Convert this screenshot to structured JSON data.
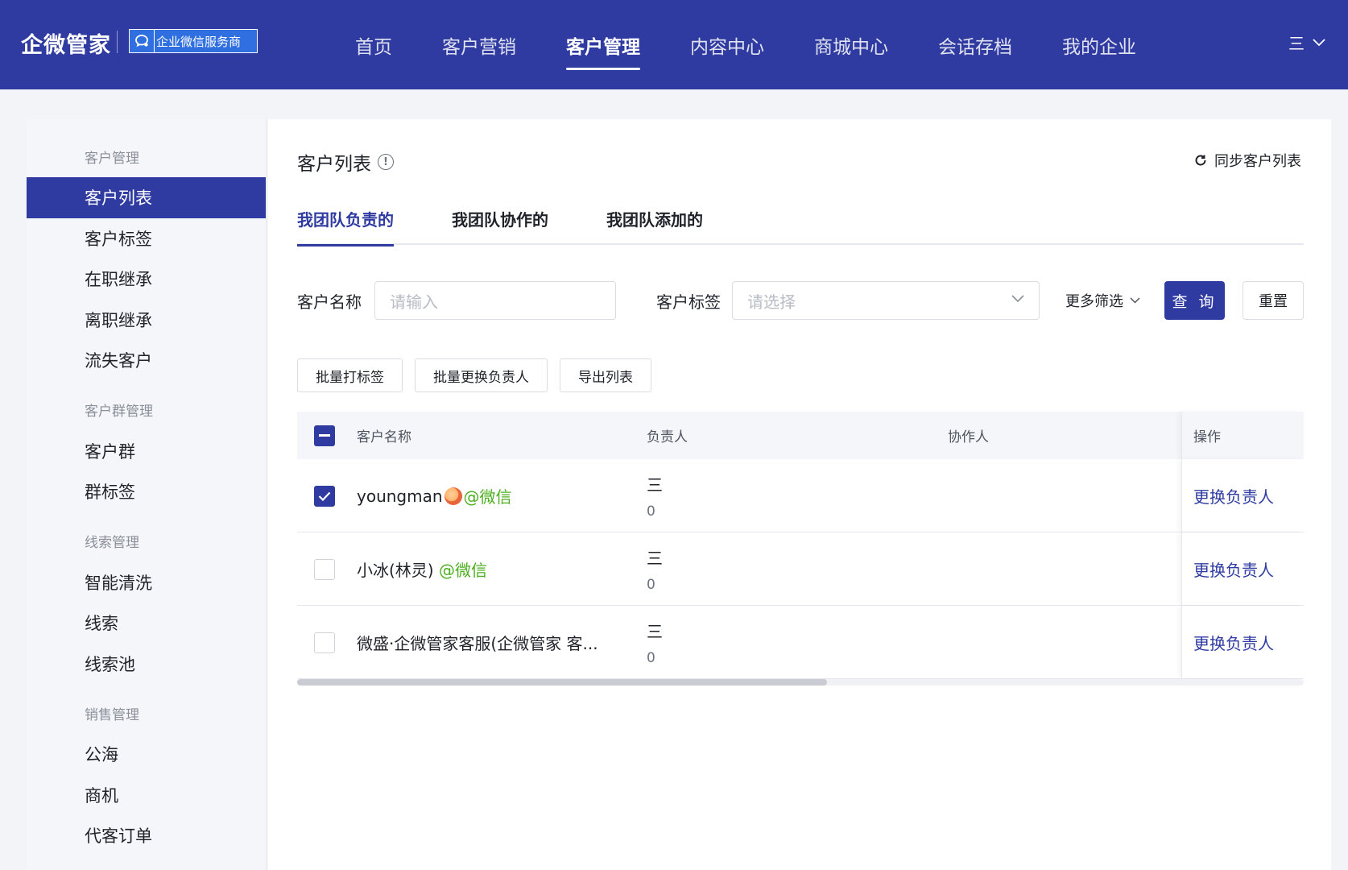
{
  "header": {
    "logo": "企微管家",
    "badge_text": "企业微信服务商",
    "nav": [
      "首页",
      "客户营销",
      "客户管理",
      "内容中心",
      "商城中心",
      "会话存档",
      "我的企业"
    ],
    "active_nav_index": 2,
    "menu_label": "三"
  },
  "sidebar": {
    "groups": [
      {
        "title": "客户管理",
        "items": [
          "客户列表",
          "客户标签",
          "在职继承",
          "离职继承",
          "流失客户"
        ]
      },
      {
        "title": "客户群管理",
        "items": [
          "客户群",
          "群标签"
        ]
      },
      {
        "title": "线索管理",
        "items": [
          "智能清洗",
          "线索",
          "线索池"
        ]
      },
      {
        "title": "销售管理",
        "items": [
          "公海",
          "商机",
          "代客订单"
        ]
      }
    ],
    "active_item": "客户列表"
  },
  "main": {
    "title": "客户列表",
    "sync_label": "同步客户列表",
    "tabs": [
      "我团队负责的",
      "我团队协作的",
      "我团队添加的"
    ],
    "active_tab_index": 0,
    "filters": {
      "name_label": "客户名称",
      "name_placeholder": "请输入",
      "tag_label": "客户标签",
      "tag_placeholder": "请选择",
      "more_filter": "更多筛选",
      "query": "查 询",
      "reset": "重置"
    },
    "actions": [
      "批量打标签",
      "批量更换负责人",
      "导出列表"
    ],
    "table": {
      "columns": [
        "客户名称",
        "负责人",
        "协作人",
        "操作"
      ],
      "rows": [
        {
          "name": "youngman",
          "source": "@微信",
          "owner": "三",
          "owner_sub": "0",
          "collaborator": "",
          "action": "更换负责人",
          "checked": true,
          "has_avatar": true
        },
        {
          "name": "小冰(林灵) ",
          "source": "@微信",
          "owner": "三",
          "owner_sub": "0",
          "collaborator": "",
          "action": "更换负责人",
          "checked": false,
          "has_avatar": false
        },
        {
          "name": "微盛·企微管家客服(企微管家 客...",
          "source": "",
          "owner": "三",
          "owner_sub": "0",
          "collaborator": "",
          "action": "更换负责人",
          "checked": false,
          "has_avatar": false
        }
      ]
    }
  },
  "colors": {
    "primary": "#2f3ba0",
    "wechat_green": "#4caf1f",
    "sidebar_bg": "#f5f6fa"
  }
}
